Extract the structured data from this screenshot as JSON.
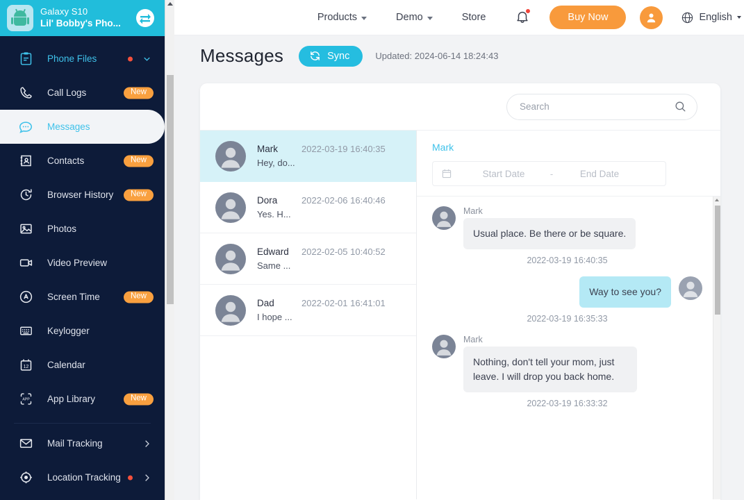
{
  "sidebar": {
    "device": {
      "model": "Galaxy S10",
      "name": "Lil' Bobby's Pho...",
      "icon": "android-robot-icon",
      "switch_icon": "switch-device-icon"
    },
    "group": {
      "label": "Phone Files",
      "icon": "clipboard-icon",
      "has_dot": true
    },
    "items": [
      {
        "label": "Call Logs",
        "icon": "phone-icon",
        "badge": "New",
        "active": false
      },
      {
        "label": "Messages",
        "icon": "chat-bubble-icon",
        "badge": "",
        "active": true
      },
      {
        "label": "Contacts",
        "icon": "contact-card-icon",
        "badge": "New",
        "active": false
      },
      {
        "label": "Browser History",
        "icon": "history-clock-icon",
        "badge": "New",
        "active": false
      },
      {
        "label": "Photos",
        "icon": "photo-icon",
        "badge": "",
        "active": false
      },
      {
        "label": "Video Preview",
        "icon": "video-camera-icon",
        "badge": "",
        "active": false
      },
      {
        "label": "Screen Time",
        "icon": "screen-time-icon",
        "badge": "New",
        "active": false
      },
      {
        "label": "Keylogger",
        "icon": "keyboard-icon",
        "badge": "",
        "active": false
      },
      {
        "label": "Calendar",
        "icon": "calendar-icon",
        "badge": "",
        "active": false
      },
      {
        "label": "App Library",
        "icon": "app-library-icon",
        "badge": "New",
        "active": false
      }
    ],
    "sections": [
      {
        "label": "Mail Tracking",
        "icon": "envelope-icon",
        "has_dot": false
      },
      {
        "label": "Location Tracking",
        "icon": "target-icon",
        "has_dot": true
      }
    ]
  },
  "topbar": {
    "nav": [
      {
        "label": "Products",
        "has_caret": true
      },
      {
        "label": "Demo",
        "has_caret": true
      },
      {
        "label": "Store",
        "has_caret": false
      }
    ],
    "bell_icon": "notification-bell-icon",
    "bell_has_dot": true,
    "buy_now_label": "Buy Now",
    "account_icon": "user-avatar-icon",
    "language": "English",
    "globe_icon": "globe-icon"
  },
  "page": {
    "title": "Messages",
    "sync_label": "Sync",
    "sync_icon": "refresh-icon",
    "updated_label": "Updated: 2024-06-14 18:24:43"
  },
  "search": {
    "placeholder": "Search",
    "value": "",
    "icon": "search-icon"
  },
  "conversations": [
    {
      "name": "Mark",
      "preview": "Hey, do...",
      "time": "2022-03-19 16:40:35",
      "selected": true
    },
    {
      "name": "Dora",
      "preview": "Yes. H...",
      "time": "2022-02-06 16:40:46",
      "selected": false
    },
    {
      "name": "Edward",
      "preview": "Same ...",
      "time": "2022-02-05 10:40:52",
      "selected": false
    },
    {
      "name": "Dad",
      "preview": "I hope ...",
      "time": "2022-02-01 16:41:01",
      "selected": false
    }
  ],
  "chat": {
    "contact": "Mark",
    "date_filter": {
      "calendar_icon": "calendar-icon",
      "start_placeholder": "Start Date",
      "end_placeholder": "End Date",
      "separator": "-"
    },
    "messages": [
      {
        "sender": "Mark",
        "text": "Usual place. Be there or be square.",
        "time": "2022-03-19 16:40:35",
        "outgoing": false
      },
      {
        "sender": "",
        "text": "Way to see you?",
        "time": "2022-03-19 16:35:33",
        "outgoing": true
      },
      {
        "sender": "Mark",
        "text": "Nothing, don't tell your mom, just leave. I will drop you back home.",
        "time": "2022-03-19 16:33:32",
        "outgoing": false
      }
    ]
  },
  "colors": {
    "sidebar_bg": "#0d1b39",
    "device_bar": "#21bddb",
    "accent_cyan": "#3fc2ea",
    "badge_orange": "#f9a03f",
    "buy_orange": "#f89a3c",
    "selected_row": "#d6f2f8",
    "bubble_in": "#f0f1f3",
    "bubble_out": "#b4e9f5",
    "page_bg": "#f2f3f5"
  }
}
